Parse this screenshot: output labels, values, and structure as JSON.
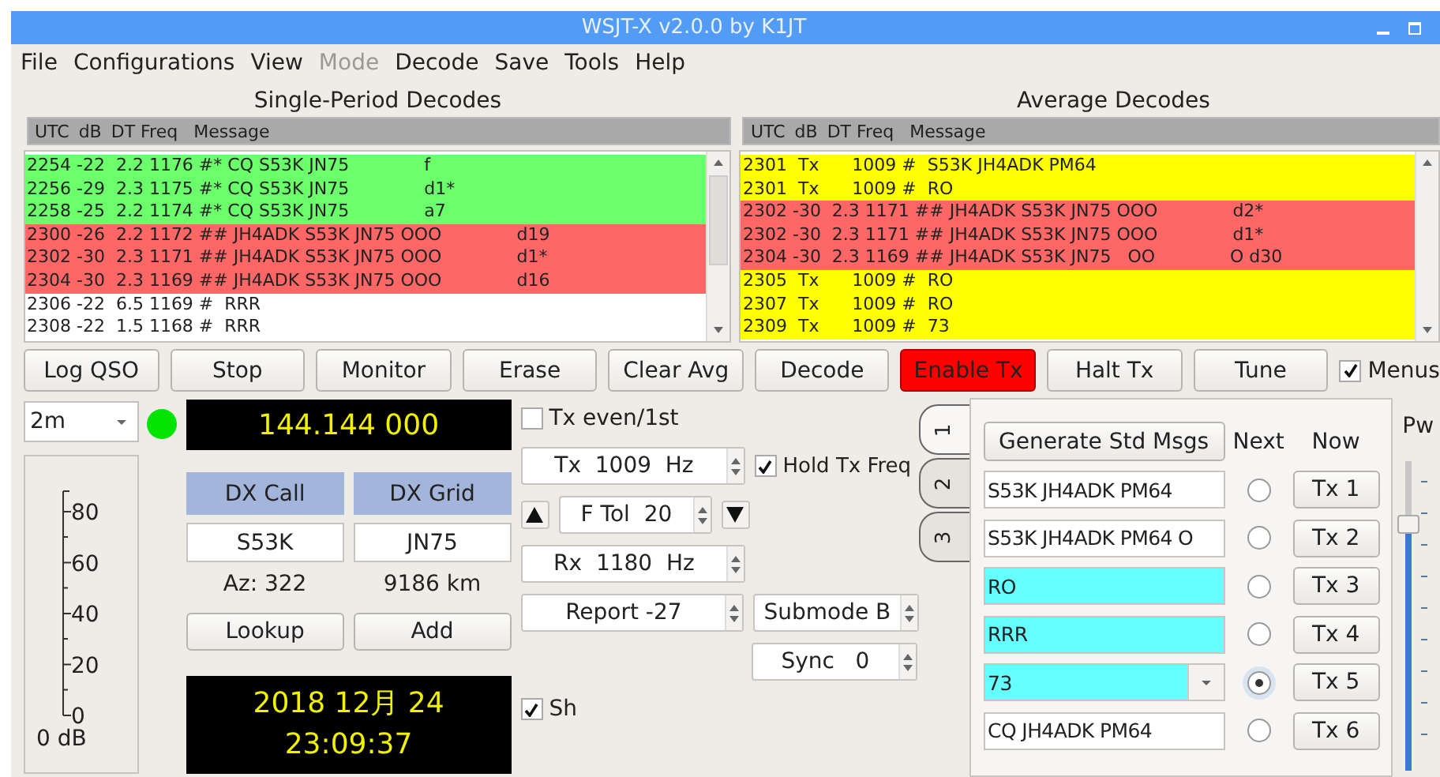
{
  "window": {
    "title": "WSJT-X   v2.0.0   by K1JT"
  },
  "menu": [
    {
      "label": "File",
      "disabled": false
    },
    {
      "label": "Configurations",
      "disabled": false
    },
    {
      "label": "View",
      "disabled": false
    },
    {
      "label": "Mode",
      "disabled": true
    },
    {
      "label": "Decode",
      "disabled": false
    },
    {
      "label": "Save",
      "disabled": false
    },
    {
      "label": "Tools",
      "disabled": false
    },
    {
      "label": "Help",
      "disabled": false
    }
  ],
  "decode_panels": [
    {
      "title": "Single-Period Decodes",
      "columns": [
        "UTC",
        "dB",
        "DT Freq",
        "Message"
      ],
      "rows": [
        {
          "text": "2254 -22  2.2 1176 #* CQ S53K JN75",
          "flag": "f",
          "color": "#6cff6c"
        },
        {
          "text": "2256 -29  2.3 1175 #* CQ S53K JN75",
          "flag": "d1*",
          "color": "#6cff6c"
        },
        {
          "text": "2258 -25  2.2 1174 #* CQ S53K JN75",
          "flag": "a7",
          "color": "#6cff6c"
        },
        {
          "text": "2300 -26  2.2 1172 ## JH4ADK S53K JN75 OOO",
          "flag": "d19",
          "color": "#ff6767"
        },
        {
          "text": "2302 -30  2.3 1171 ## JH4ADK S53K JN75 OOO",
          "flag": "d1*",
          "color": "#ff6767"
        },
        {
          "text": "2304 -30  2.3 1169 ## JH4ADK S53K JN75 OOO",
          "flag": "d16",
          "color": "#ff6767"
        },
        {
          "text": "2306 -22  6.5 1169 #  RRR",
          "color": "#ffffff"
        },
        {
          "text": "2308 -22  1.5 1168 #  RRR",
          "color": "#ffffff"
        }
      ]
    },
    {
      "title": "Average Decodes",
      "columns": [
        "UTC",
        "dB",
        "DT Freq",
        "Message"
      ],
      "rows": [
        {
          "text": "2301  Tx      1009 #  S53K JH4ADK PM64",
          "color": "#ffff00"
        },
        {
          "text": "2301  Tx      1009 #  RO",
          "color": "#ffff00"
        },
        {
          "text": "2302 -30  2.3 1171 ## JH4ADK S53K JN75 OOO",
          "flag": "d2*",
          "color": "#ff6767"
        },
        {
          "text": "2302 -30  2.3 1171 ## JH4ADK S53K JN75 OOO",
          "flag": "d1*",
          "color": "#ff6767"
        },
        {
          "text": "2304 -30  2.3 1169 ## JH4ADK S53K JN75   OO",
          "flag": "O d30",
          "color": "#ff6767"
        },
        {
          "text": "2305  Tx      1009 #  RO",
          "color": "#ffff00"
        },
        {
          "text": "2307  Tx      1009 #  RO",
          "color": "#ffff00"
        },
        {
          "text": "2309  Tx      1009 #  73",
          "color": "#ffff00"
        }
      ]
    }
  ],
  "buttons": [
    {
      "label": "Log QSO",
      "kind": "normal"
    },
    {
      "label": "Stop",
      "kind": "normal"
    },
    {
      "label": "Monitor",
      "kind": "normal"
    },
    {
      "label": "Erase",
      "kind": "normal"
    },
    {
      "label": "Clear Avg",
      "kind": "normal"
    },
    {
      "label": "Decode",
      "kind": "normal"
    },
    {
      "label": "Enable Tx",
      "kind": "alert"
    },
    {
      "label": "Halt Tx",
      "kind": "normal"
    },
    {
      "label": "Tune",
      "kind": "normal"
    }
  ],
  "menus_toggle": {
    "label": "Menus",
    "checked": true
  },
  "band": {
    "value": "2m"
  },
  "monitor_led": {
    "on": true
  },
  "frequency": "144.144 000",
  "meter": {
    "ticks": [
      "80",
      "60",
      "40",
      "20",
      "0"
    ],
    "unit": "0 dB"
  },
  "dx": {
    "call_label": "DX Call",
    "grid_label": "DX Grid",
    "call": "S53K",
    "grid": "JN75",
    "azimuth": "Az: 322",
    "distance": "9186 km",
    "lookup": "Lookup",
    "add": "Add"
  },
  "clock": {
    "date": "2018 12月 24",
    "time": "23:09:37"
  },
  "tx_even": {
    "label": "Tx even/1st",
    "checked": false
  },
  "tx_freq": "Tx  1009  Hz",
  "hold_tx_freq": {
    "label": "Hold Tx Freq",
    "checked": true
  },
  "f_tol": "F Tol  20",
  "rx_freq": "Rx  1180  Hz",
  "report": "Report -27",
  "submode": "Submode B",
  "sync": "Sync   0",
  "sh": {
    "label": "Sh",
    "checked": true
  },
  "tabs": [
    {
      "label": "1",
      "selected": true
    },
    {
      "label": "2",
      "selected": false
    },
    {
      "label": "3",
      "selected": false
    }
  ],
  "tx_panel": {
    "generate": "Generate Std Msgs",
    "next_label": "Next",
    "now_label": "Now",
    "messages": [
      {
        "text": "S53K JH4ADK PM64",
        "kind": "field",
        "highlighted": false,
        "selected": false,
        "button": "Tx 1"
      },
      {
        "text": "S53K JH4ADK PM64 O",
        "kind": "field",
        "highlighted": false,
        "selected": false,
        "button": "Tx 2"
      },
      {
        "text": "RO",
        "kind": "field",
        "highlighted": true,
        "selected": false,
        "button": "Tx 3"
      },
      {
        "text": "RRR",
        "kind": "field",
        "highlighted": true,
        "selected": false,
        "button": "Tx 4"
      },
      {
        "text": "73",
        "kind": "combo",
        "highlighted": true,
        "selected": true,
        "button": "Tx 5"
      },
      {
        "text": "CQ JH4ADK PM64",
        "kind": "field",
        "highlighted": false,
        "selected": false,
        "button": "Tx 6"
      }
    ]
  },
  "power": {
    "label": "Pw",
    "level": 0.8
  }
}
